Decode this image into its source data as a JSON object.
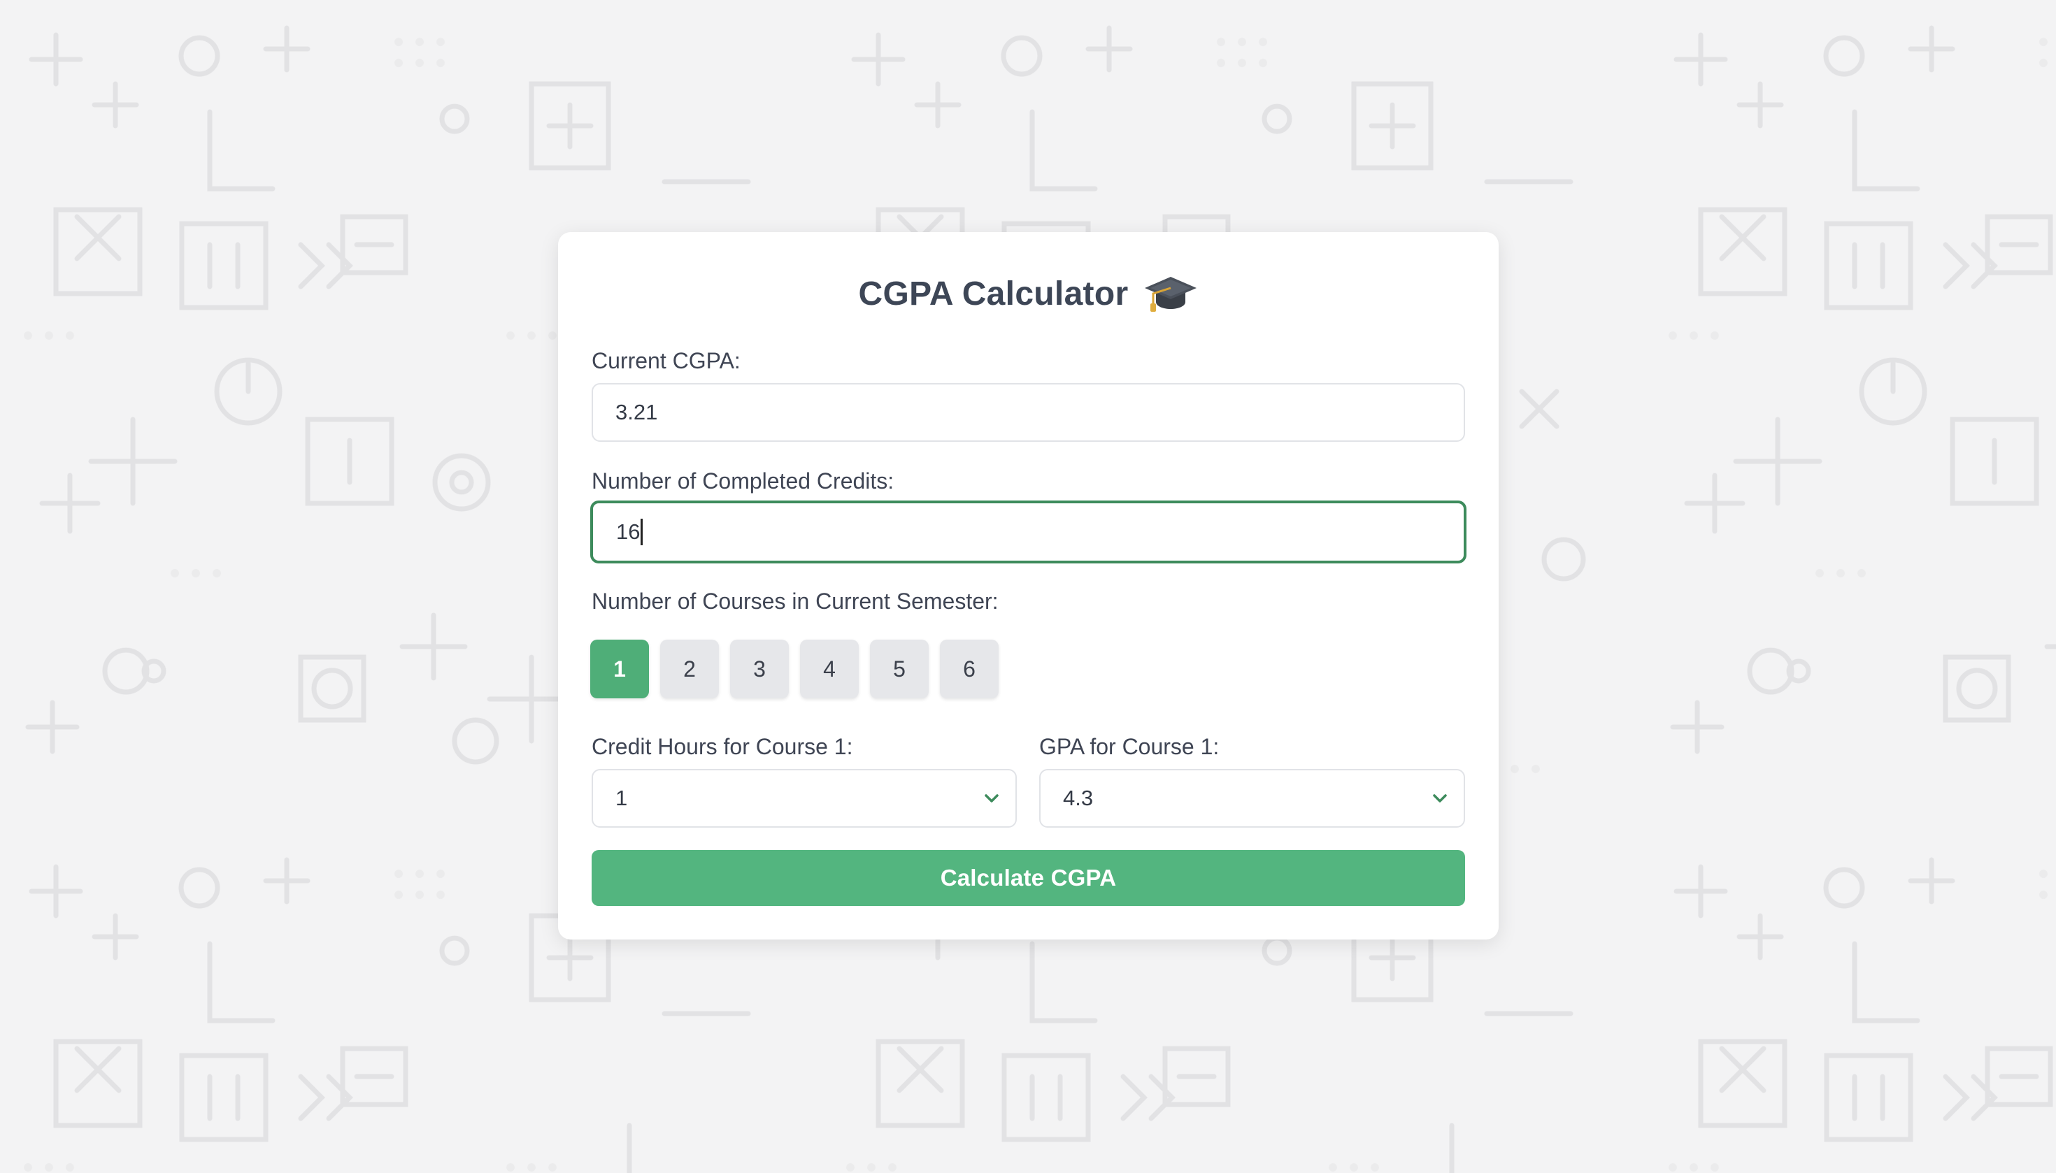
{
  "app": {
    "title": "CGPA Calculator",
    "title_icon": "graduation-cap-icon"
  },
  "form": {
    "current_cgpa": {
      "label": "Current CGPA:",
      "value": "3.21"
    },
    "completed_credits": {
      "label": "Number of Completed Credits:",
      "value": "16"
    },
    "courses": {
      "label": "Number of Courses in Current Semester:",
      "options": [
        "1",
        "2",
        "3",
        "4",
        "5",
        "6"
      ],
      "selected": "1"
    },
    "course_1": {
      "credit_label": "Credit Hours for Course 1:",
      "credit_value": "1",
      "gpa_label": "GPA for Course 1:",
      "gpa_value": "4.3"
    },
    "calculate_label": "Calculate CGPA"
  },
  "colors": {
    "accent": "#53b57f",
    "focus_border": "#3d8b5c",
    "background": "#f3f3f4"
  }
}
